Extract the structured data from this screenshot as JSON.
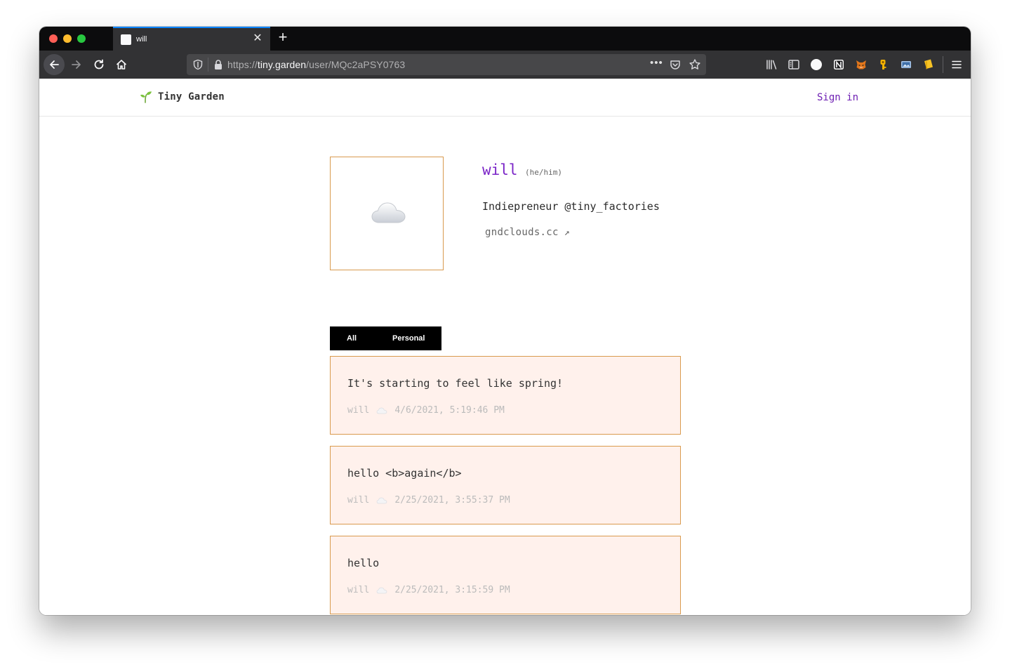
{
  "browser": {
    "tab_title": "will",
    "tab_close": "✕",
    "new_tab": "+",
    "url_scheme": "https://",
    "url_host": "tiny.garden",
    "url_path": "/user/MQc2aPSY0763",
    "page_actions": "•••"
  },
  "site": {
    "brand": "Tiny Garden",
    "sign_in": "Sign in"
  },
  "profile": {
    "name": "will",
    "pronouns": "(he/him)",
    "bio": "Indiepreneur @tiny_factories",
    "website": "gndclouds.cc",
    "website_arrow": "↗"
  },
  "filter_tabs": {
    "all": "All",
    "personal": "Personal"
  },
  "posts": [
    {
      "text": "It's starting to feel like spring!",
      "author": "will",
      "timestamp": "4/6/2021, 5:19:46 PM"
    },
    {
      "text": "hello <b>again</b>",
      "author": "will",
      "timestamp": "2/25/2021, 3:55:37 PM"
    },
    {
      "text": "hello",
      "author": "will",
      "timestamp": "2/25/2021, 3:15:59 PM"
    }
  ],
  "colors": {
    "accent": "#7a24c7",
    "post_background": "#fff1ec",
    "post_border": "#d99a4e",
    "browser_chrome": "#323234"
  }
}
